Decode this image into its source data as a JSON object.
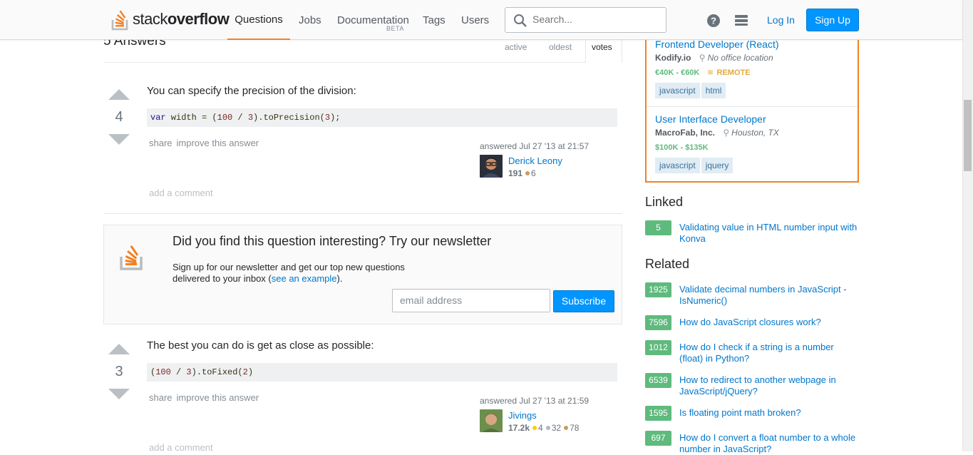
{
  "header": {
    "logo_pre": "stack",
    "logo_post": "overflow",
    "nav": [
      "Questions",
      "Jobs",
      "Documentation",
      "Tags",
      "Users"
    ],
    "doc_badge": "BETA",
    "search_placeholder": "Search...",
    "login": "Log In",
    "signup": "Sign Up"
  },
  "answers": {
    "count_label": "5 Answers",
    "sort_tabs": [
      "active",
      "oldest",
      "votes"
    ]
  },
  "answer1": {
    "votes": "4",
    "text": "You can specify the precision of the division:",
    "code_kw": "var",
    "code_rest1": " width = (",
    "code_n1": "100",
    "code_rest2": " / ",
    "code_n2": "3",
    "code_rest3": ").toPrecision(",
    "code_n3": "3",
    "code_rest4": ");",
    "share": "share",
    "improve": "improve this answer",
    "answered": "answered Jul 27 '13 at 21:57",
    "user": "Derick Leony",
    "rep": "191",
    "bronze": "6",
    "add_comment": "add a comment"
  },
  "newsletter": {
    "title": "Did you find this question interesting? Try our newsletter",
    "desc_pre": "Sign up for our newsletter and get our top new questions delivered to your inbox (",
    "desc_link": "see an example",
    "desc_post": ").",
    "email_placeholder": "email address",
    "subscribe": "Subscribe"
  },
  "answer2": {
    "votes": "3",
    "text": "The best you can do is get as close as possible:",
    "code_p1": "(",
    "code_n1": "100",
    "code_p2": " / ",
    "code_n2": "3",
    "code_p3": ").toFixed(",
    "code_n3": "2",
    "code_p4": ")",
    "share": "share",
    "improve": "improve this answer",
    "answered": "answered Jul 27 '13 at 21:59",
    "user": "Jivings",
    "rep": "17.2k",
    "gold": "4",
    "silver": "32",
    "bronze": "78",
    "add_comment": "add a comment"
  },
  "jobs": [
    {
      "title": "Frontend Developer (React)",
      "company": "Kodify.io",
      "location": "No office location",
      "salary": "€40K - €60K",
      "remote": "REMOTE",
      "tags": [
        "javascript",
        "html"
      ]
    },
    {
      "title": "User Interface Developer",
      "company": "MacroFab, Inc.",
      "location": "Houston, TX",
      "salary": "$100K - $135K",
      "tags": [
        "javascript",
        "jquery"
      ]
    }
  ],
  "linked": {
    "heading": "Linked",
    "items": [
      {
        "score": "5",
        "title": "Validating value in HTML number input with Konva"
      }
    ]
  },
  "related": {
    "heading": "Related",
    "items": [
      {
        "score": "1925",
        "title": "Validate decimal numbers in JavaScript - IsNumeric()"
      },
      {
        "score": "7596",
        "title": "How do JavaScript closures work?"
      },
      {
        "score": "1012",
        "title": "How do I check if a string is a number (float) in Python?"
      },
      {
        "score": "6539",
        "title": "How to redirect to another webpage in JavaScript/jQuery?"
      },
      {
        "score": "1595",
        "title": "Is floating point math broken?"
      },
      {
        "score": "697",
        "title": "How do I convert a float number to a whole number in JavaScript?"
      }
    ]
  },
  "colors": {
    "accent": "#f48024",
    "link": "#0077cc",
    "badge": "#5fba7d",
    "button": "#0095ff"
  }
}
